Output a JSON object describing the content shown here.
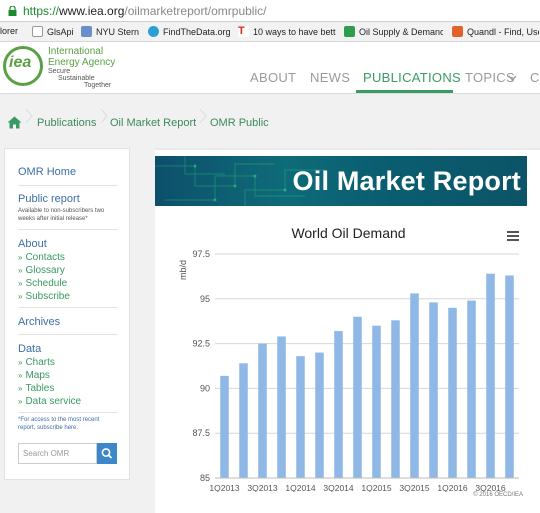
{
  "browser": {
    "url_scheme": "https://",
    "url_host": "www.iea.org",
    "url_path": "/oilmarketreport/omrpublic/",
    "bookmarks": [
      "lorer",
      "GlsApi",
      "NYU Stern",
      "FindTheData.org",
      "10 ways to have bett",
      "Oil Supply & Demanc",
      "Quandl - Find, Use"
    ]
  },
  "site": {
    "logo": "iea",
    "org_line1": "International",
    "org_line2": "Energy Agency",
    "tag1": "Secure",
    "tag2": "Sustainable",
    "tag3": "Together",
    "nav": [
      "ABOUT",
      "NEWS",
      "PUBLICATIONS",
      "TOPICS",
      "C"
    ],
    "nav_active": "PUBLICATIONS"
  },
  "breadcrumb": [
    "Publications",
    "Oil Market Report",
    "OMR Public"
  ],
  "sidebar": {
    "home": "OMR Home",
    "public_report": "Public report",
    "public_note": "Available to non-subscribers two weeks after initial release*",
    "about": "About",
    "about_links": [
      "Contacts",
      "Glossary",
      "Schedule",
      "Subscribe"
    ],
    "archives": "Archives",
    "data": "Data",
    "data_links": [
      "Charts",
      "Maps",
      "Tables",
      "Data service"
    ],
    "footnote": "*For access to the most recent report, subscribe here.",
    "search_placeholder": "Search OMR"
  },
  "main": {
    "banner_title": "Oil Market Report",
    "credit": "© 2016 OECD/IEA"
  },
  "colors": {
    "accent_green": "#3a9a63",
    "bar_blue": "#8fb8e6",
    "link_blue": "#3d6ea6"
  },
  "chart_data": {
    "type": "bar",
    "title": "World Oil Demand",
    "ylabel": "mb/d",
    "xlabel": "",
    "ylim": [
      85,
      97.5
    ],
    "yticks": [
      85,
      87.5,
      90,
      92.5,
      95,
      97.5
    ],
    "ytick_labels": [
      "85",
      "87.5",
      "90",
      "92.5",
      "95",
      "97.5"
    ],
    "categories": [
      "1Q2013",
      "2Q2013",
      "3Q2013",
      "4Q2013",
      "1Q2014",
      "2Q2014",
      "3Q2014",
      "4Q2014",
      "1Q2015",
      "2Q2015",
      "3Q2015",
      "4Q2015",
      "1Q2016",
      "2Q2016",
      "3Q2016",
      "4Q2016"
    ],
    "xtick_labels": [
      "1Q2013",
      "3Q2013",
      "1Q2014",
      "3Q2014",
      "1Q2015",
      "3Q2015",
      "1Q2016",
      "3Q2016"
    ],
    "values": [
      90.7,
      91.4,
      92.5,
      92.9,
      91.8,
      92.0,
      93.2,
      94.0,
      93.5,
      93.8,
      95.3,
      94.8,
      94.5,
      94.9,
      96.4,
      96.3
    ],
    "grid": true,
    "legend": "none"
  }
}
